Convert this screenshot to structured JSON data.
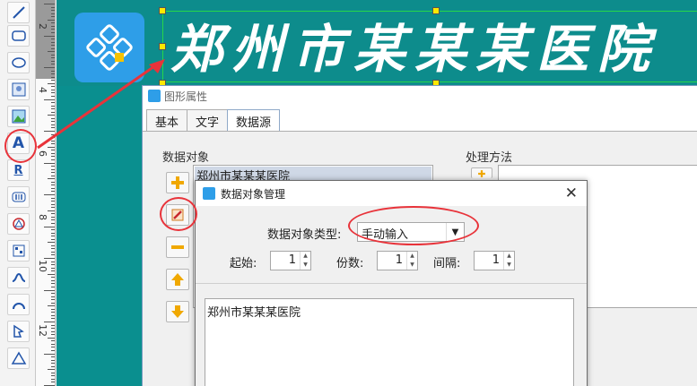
{
  "toolbar": {
    "tools": [
      {
        "icon": "line-icon"
      },
      {
        "icon": "rounded-rect-icon"
      },
      {
        "icon": "ellipse-icon"
      },
      {
        "icon": "image-icon"
      },
      {
        "icon": "picture-icon"
      },
      {
        "icon": "text-icon",
        "glyph": "A"
      },
      {
        "icon": "rich-text-icon",
        "glyph": "R"
      },
      {
        "icon": "barcode-icon"
      },
      {
        "icon": "qrcode-icon"
      },
      {
        "icon": "datamatrix-icon"
      },
      {
        "icon": "curve-icon"
      },
      {
        "icon": "arc-icon"
      },
      {
        "icon": "polygon-icon"
      },
      {
        "icon": "triangle-icon"
      }
    ]
  },
  "ruler": {
    "numbers": [
      "2",
      "4",
      "6",
      "8",
      "10",
      "12"
    ]
  },
  "label": {
    "title": "郑州市某某某医院"
  },
  "property_dialog": {
    "title": "图形属性",
    "tabs": [
      "基本",
      "文字",
      "数据源"
    ],
    "data_object_label": "数据对象",
    "process_method_label": "处理方法",
    "data_object_item": "郑州市某某某医院"
  },
  "manager_dialog": {
    "title": "数据对象管理",
    "close": "✕",
    "type_label": "数据对象类型:",
    "type_value": "手动输入",
    "start_label": "起始:",
    "start_value": "1",
    "copies_label": "份数:",
    "copies_value": "1",
    "interval_label": "间隔:",
    "interval_value": "1",
    "content": "郑州市某某某医院"
  },
  "colors": {
    "canvas": "#0a8f8f",
    "accent_red": "#e8333a",
    "logo_blue": "#2e9ee8"
  }
}
